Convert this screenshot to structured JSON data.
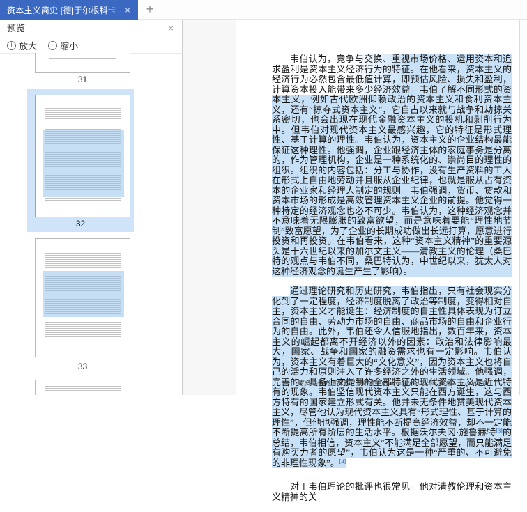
{
  "browser": {
    "tab_title": "资本主义简史 [德]于尔根科卡著",
    "tab_close_label": "×",
    "new_tab_label": "+"
  },
  "preview_panel": {
    "title": "预览",
    "close_label": "×",
    "zoom_in_label": "放大",
    "zoom_out_label": "缩小",
    "zoom_in_icon": "+",
    "zoom_out_icon": "−",
    "thumbnails": [
      {
        "page": "31",
        "selected": false
      },
      {
        "page": "32",
        "selected": true
      },
      {
        "page": "33",
        "selected": false
      }
    ]
  },
  "document": {
    "p1": "韦伯认为，竞争与交换、重视市场价格、运用资本和追求盈利是资本主义经济行为的特征。在他看来，资本主义的经济行为必然包含最低值计算，即预估风险、损失和盈利，计算资本投入能带来多少经济效益。韦伯了解不同形式的资本主义，例如古代欧洲仰赖政治的资本主义和食利资本主义，还有“掠夺式资本主义”，它自古以来就与战争和劫掠关系密切，也会出现在现代金融资本主义的投机和剥削行为中。但韦伯对现代资本主义最感兴趣，它的特征是形式理性、基于计算的理性。韦伯认为，资本主义的企业结构最能保证这种理性。他强调，企业跟经济主体的家庭事务是分离的，作为管理机构，企业是一种系统化的、崇尚目的理性的组织。组织的内容包括：分工与协作，没有生产资料的工人在形式上自由地劳动并且服从企业纪律，也就是服从占有资本的企业家和经理人制定的规则。韦伯强调，货币、贷款和资本市场的形成是高效管理资本主义企业的前提。他觉得一种特定的经济观念也必不可少。韦伯认为，这种经济观念并不意味着无限膨胀的致富欲望，而是意味着要能“理性地节制”致富愿望，为了企业的长期成功做出长远打算，愿意进行投资和再投资。在韦伯看来，这种“资本主义精神”的重要源头是十六世纪以来的加尔文主义——清教主义的伦理（桑巴特的观点与韦伯不同，桑巴特认为，中世纪以来，犹太人对这种经济观念的诞生产生了影响）。",
    "p2_before_ref3": "通过理论研究和历史研究，韦伯指出，只有社会现实分化到了一定程度，经济制度脱离了政治等制度，变得相对自主，资本主义才能诞生：经济制度的自主性具体表现为订立合同的自由、劳动力市场的自由、商品市场的自由和企业行为的自由。此外，韦伯还令人信服地指出，数百年来，资本主义的崛起都离不开经济以外的因素：政治和法律影响最大，国家、战争和国家的融资需求也有一定影响。韦伯认为，资本主义有着巨大的“文化意义”，因为资本主义也将自己的活力和原则注入了许多经济之外的生活领域。他强调，完善的、具备上文提到的全部特征的现代资本主义是近代特有的现象。韦伯坚信现代资本主义只能在西方诞生，这与西方特有的国家建立形式有关。他并未无条件地赞美现代资本主义，尽管他认为现代资本主义具有“形式理性、基于计算的理性”，但他也强调，理性能不断提高经济效益，却不一定能不断提高所有阶层的生活水平。根据沃尔夫冈·施鲁赫特",
    "ref3": "[3]",
    "p2_between_refs": "的总结，韦伯相信，资本主义“不能满足全部愿望，而只能满足有购买力者的愿望”，韦伯认为这是一种“严重的、不可避免的非理性现象”。",
    "ref4": "[4]",
    "p3": "对于韦伯理论的批评也很常见。他对清教伦理和资本主义精神的关",
    "footer": "更多电子书请搜索「慧眼看」www.huiyankan.com  微信：huiyankan"
  },
  "colors": {
    "active_tab_blue": "#3b69c2",
    "selection_highlight": "#c9e1f6",
    "reference_link_blue": "#2a5db0",
    "thumbnail_selected_bg": "#cfe4f8"
  }
}
